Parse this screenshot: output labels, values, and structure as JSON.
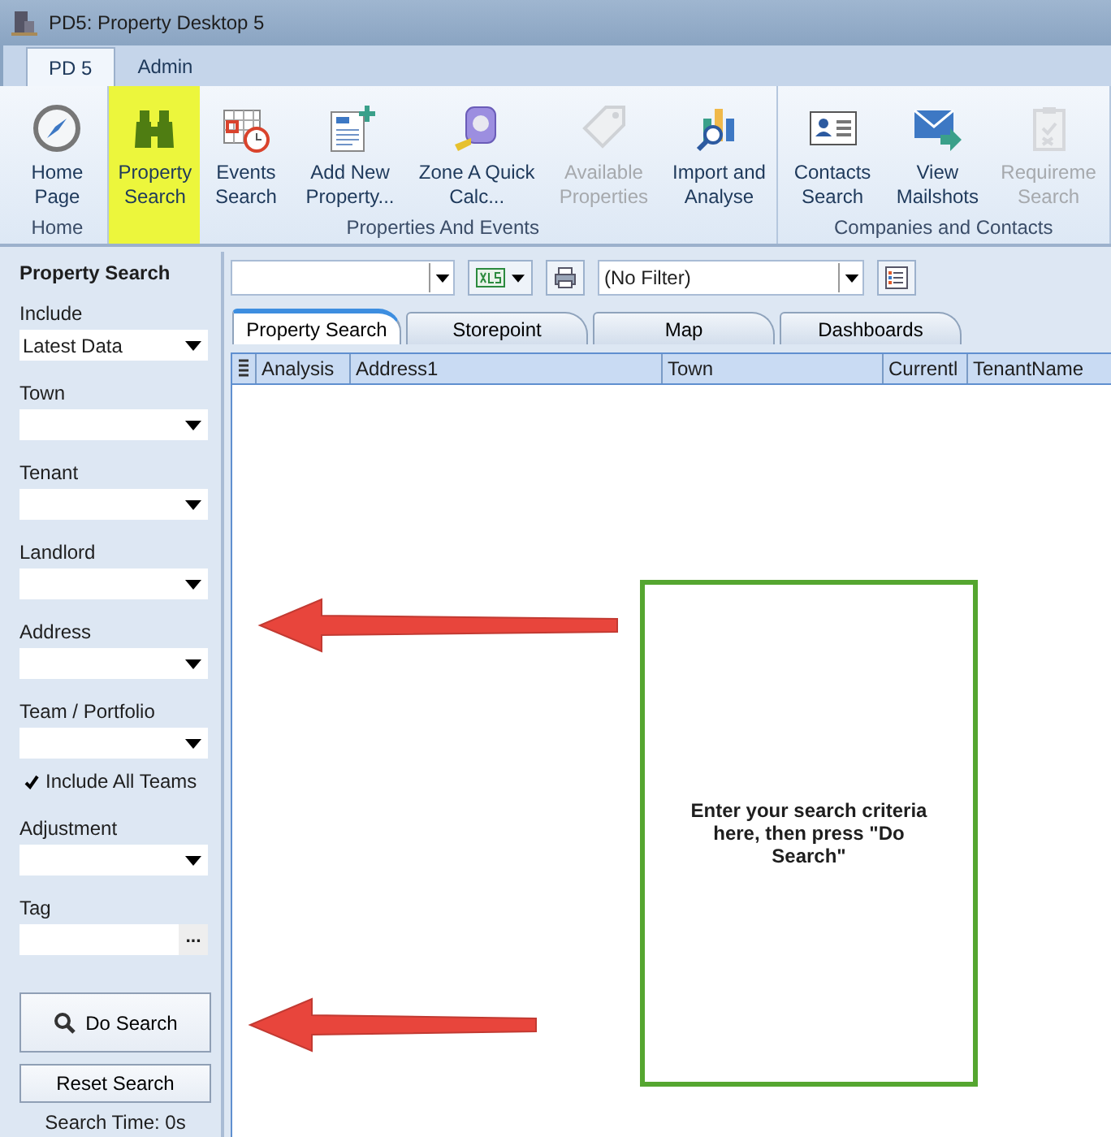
{
  "window": {
    "title": "PD5: Property Desktop 5"
  },
  "ribbon_tabs": [
    {
      "label": "PD 5",
      "selected": true
    },
    {
      "label": "Admin",
      "selected": false
    }
  ],
  "ribbon_groups": [
    {
      "label": "Home",
      "buttons": [
        {
          "label": "Home Page",
          "disabled": false,
          "highlighted": false
        }
      ]
    },
    {
      "label": "Properties And Events",
      "buttons": [
        {
          "label": "Property Search",
          "disabled": false,
          "highlighted": true
        },
        {
          "label": "Events Search",
          "disabled": false,
          "highlighted": false
        },
        {
          "label": "Add New Property...",
          "disabled": false,
          "highlighted": false
        },
        {
          "label": "Zone A Quick Calc...",
          "disabled": false,
          "highlighted": false
        },
        {
          "label": "Available Properties",
          "disabled": true,
          "highlighted": false
        },
        {
          "label": "Import and Analyse",
          "disabled": false,
          "highlighted": false
        }
      ]
    },
    {
      "label": "Companies and Contacts",
      "buttons": [
        {
          "label": "Contacts Search",
          "disabled": false,
          "highlighted": false
        },
        {
          "label": "View Mailshots",
          "disabled": false,
          "highlighted": false
        },
        {
          "label": "Requireme Search",
          "disabled": true,
          "highlighted": false
        }
      ]
    }
  ],
  "sidebar": {
    "title": "Property Search",
    "fields": [
      {
        "kind": "dropdown",
        "label": "Include",
        "value": "Latest Data"
      },
      {
        "kind": "dropdown",
        "label": "Town"
      },
      {
        "kind": "dropdown",
        "label": "Tenant"
      },
      {
        "kind": "dropdown",
        "label": "Landlord"
      },
      {
        "kind": "dropdown",
        "label": "Address"
      },
      {
        "kind": "dropdown",
        "label": "Team / Portfolio"
      },
      {
        "kind": "checkbox",
        "label": "Include All Teams",
        "checked": true
      },
      {
        "kind": "dropdown",
        "label": "Adjustment"
      },
      {
        "kind": "ellipsis",
        "label": "Tag",
        "button": "..."
      }
    ],
    "search_button": "Do Search",
    "reset_button": "Reset Search",
    "search_time": "Search Time: 0s"
  },
  "toolbar": {
    "filter": "(No Filter)"
  },
  "tabs": [
    {
      "label": "Property Search",
      "selected": true
    },
    {
      "label": "Storepoint",
      "selected": false
    },
    {
      "label": "Map",
      "selected": false
    },
    {
      "label": "Dashboards",
      "selected": false
    }
  ],
  "table": {
    "columns": [
      "Analysis",
      "Address1",
      "Town",
      "Currentl",
      "TenantName"
    ]
  },
  "annotation": {
    "text": "Enter your search criteria here, then press \"Do Search\""
  }
}
